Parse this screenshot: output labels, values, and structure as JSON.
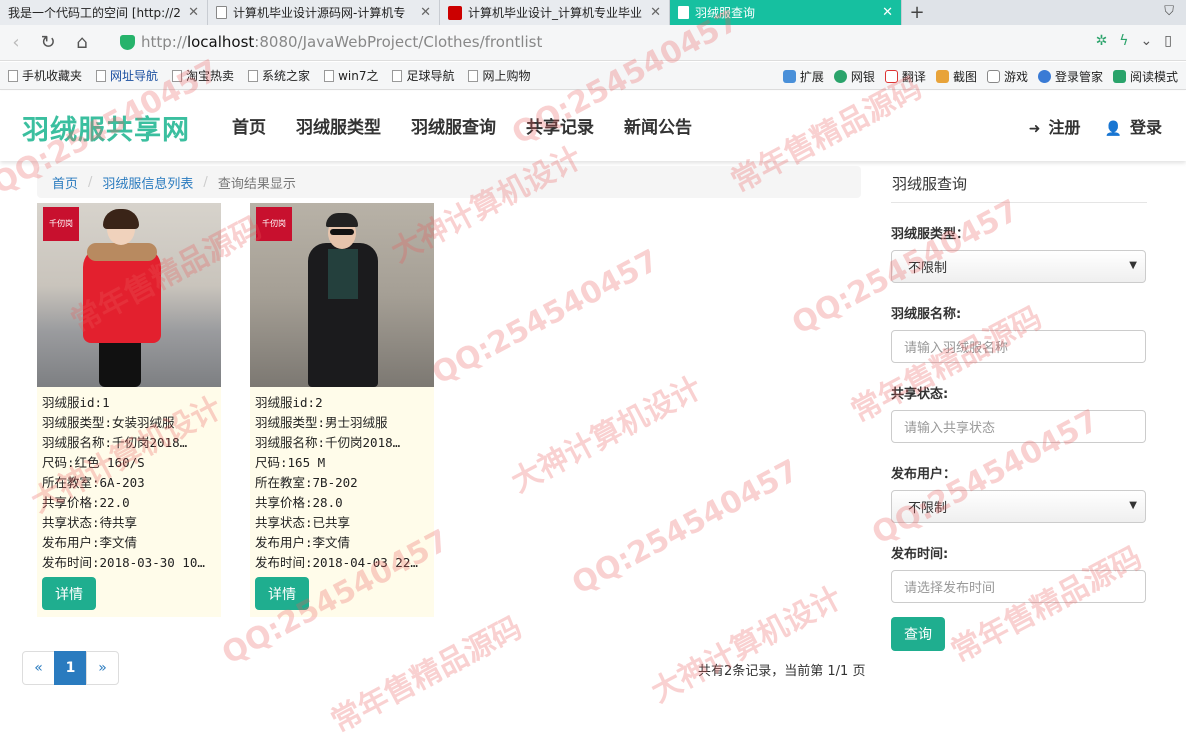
{
  "browser": {
    "tabs": [
      {
        "title": "我是一个代码工的空间 [http://2",
        "active": false
      },
      {
        "title": "计算机毕业设计源码网-计算机专",
        "active": false
      },
      {
        "title": "计算机毕业设计_计算机专业毕业",
        "active": false
      },
      {
        "title": "羽绒服查询",
        "active": true
      }
    ],
    "url_prefix": "http://",
    "url_host": "localhost",
    "url_rest": ":8080/JavaWebProject/Clothes/frontlist",
    "bookmarks": [
      "手机收藏夹",
      "网址导航",
      "淘宝热卖",
      "系统之家",
      "win7之",
      "足球导航",
      "网上购物"
    ],
    "tools": [
      "扩展",
      "网银",
      "翻译",
      "截图",
      "游戏",
      "登录管家",
      "阅读模式"
    ]
  },
  "site": {
    "brand": "羽绒服共享网",
    "nav": [
      "首页",
      "羽绒服类型",
      "羽绒服查询",
      "共享记录",
      "新闻公告"
    ],
    "register": "注册",
    "login": "登录"
  },
  "breadcrumb": [
    "首页",
    "羽绒服信息列表",
    "查询结果显示"
  ],
  "products": [
    {
      "logo": "千仞岗",
      "lines": [
        "羽绒服id:1",
        "羽绒服类型:女装羽绒服",
        "羽绒服名称:千仞岗2018…",
        "尺码:红色 160/S",
        "所在教室:6A-203",
        "共享价格:22.0",
        "共享状态:待共享",
        "发布用户:李文倩",
        "发布时间:2018-03-30 10…"
      ],
      "detail": "详情"
    },
    {
      "logo": "千仞岗",
      "lines": [
        "羽绒服id:2",
        "羽绒服类型:男士羽绒服",
        "羽绒服名称:千仞岗2018…",
        "尺码:165 M",
        "所在教室:7B-202",
        "共享价格:28.0",
        "共享状态:已共享",
        "发布用户:李文倩",
        "发布时间:2018-04-03 22…"
      ],
      "detail": "详情"
    }
  ],
  "pager": {
    "prev": "«",
    "current": "1",
    "next": "»",
    "summary": "共有2条记录，当前第 1/1 页"
  },
  "search": {
    "title": "羽绒服查询",
    "type_label": "羽绒服类型：",
    "type_value": "不限制",
    "name_label": "羽绒服名称:",
    "name_placeholder": "请输入羽绒服名称",
    "state_label": "共享状态:",
    "state_placeholder": "请输入共享状态",
    "user_label": "发布用户：",
    "user_value": "不限制",
    "time_label": "发布时间:",
    "time_placeholder": "请选择发布时间",
    "submit": "查询"
  },
  "watermarks": [
    "QQ:254540457",
    "大神计算机设计",
    "常年售精品源码"
  ],
  "colors": {
    "brand": "#3bbf9f",
    "button": "#1fae8f",
    "link": "#2a7bbf",
    "active_tab": "#16c0a0"
  }
}
